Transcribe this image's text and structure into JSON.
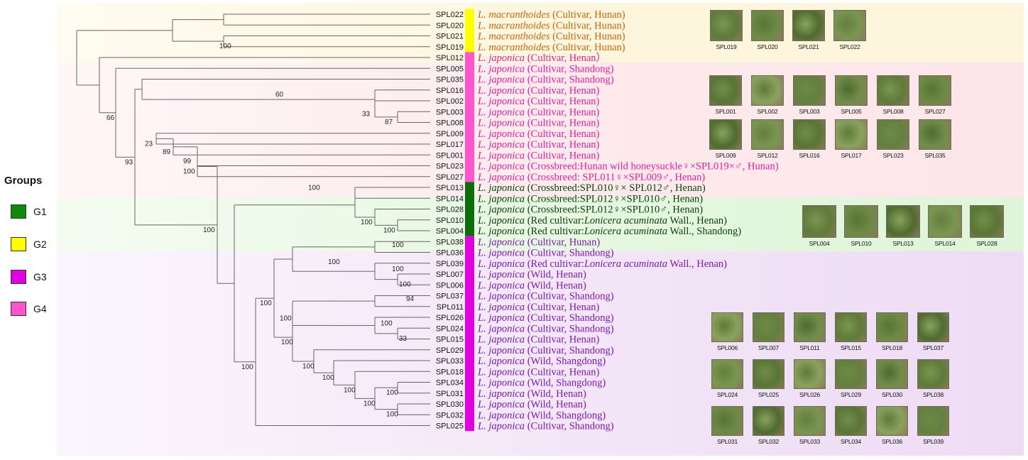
{
  "legend": {
    "title": "Groups",
    "items": [
      {
        "label": "G1",
        "color": "#0b8a0b"
      },
      {
        "label": "G2",
        "color": "#ffff00"
      },
      {
        "label": "G3",
        "color": "#e000e0"
      },
      {
        "label": "G4",
        "color": "#ff55cc"
      }
    ]
  },
  "taxa": [
    {
      "id": "SPL022",
      "species": "L. macranthoides",
      "detail": " (Cultivar, Hunan)",
      "color": "#c8640a"
    },
    {
      "id": "SPL020",
      "species": "L. macranthoides",
      "detail": " (Cultivar, Hunan)",
      "color": "#c8640a"
    },
    {
      "id": "SPL021",
      "species": "L. macranthoides",
      "detail": " (Cultivar, Hunan)",
      "color": "#c8640a"
    },
    {
      "id": "SPL019",
      "species": "L. macranthoides",
      "detail": " (Cultivar, Hunan)",
      "color": "#c8640a"
    },
    {
      "id": "SPL012",
      "species": "L. japonica",
      "detail": " (Cultivar, Henan）",
      "color": "#e0209a"
    },
    {
      "id": "SPL005",
      "species": "L. japonica",
      "detail": " (Cultivar, Shandong)",
      "color": "#e0209a"
    },
    {
      "id": "SPL035",
      "species": "L. japonica",
      "detail": " (Cultivar, Shandong)",
      "color": "#e0209a"
    },
    {
      "id": "SPL016",
      "species": "L. japonica",
      "detail": " (Cultivar, Henan)",
      "color": "#e0209a"
    },
    {
      "id": "SPL002",
      "species": "L. japonica",
      "detail": " (Cultivar, Henan)",
      "color": "#e0209a"
    },
    {
      "id": "SPL003",
      "species": "L. japonica",
      "detail": " (Cultivar, Henan)",
      "color": "#e0209a"
    },
    {
      "id": "SPL008",
      "species": "L. japonica",
      "detail": " (Cultivar, Henan)",
      "color": "#e0209a"
    },
    {
      "id": "SPL009",
      "species": "L. japonica",
      "detail": " (Cultivar, Henan)",
      "color": "#e0209a"
    },
    {
      "id": "SPL017",
      "species": "L. japonica",
      "detail": " (Cultivar, Henan)",
      "color": "#e0209a"
    },
    {
      "id": "SPL001",
      "species": "L. japonica",
      "detail": " (Cultivar, Henan)",
      "color": "#e0209a"
    },
    {
      "id": "SPL023",
      "species": "L. japonica",
      "detail": " (Crossbreed:Hunan wild honeysuckle♀×SPL019×♂, Hunan)",
      "color": "#e0209a"
    },
    {
      "id": "SPL027",
      "species": "L. japonica",
      "detail": " (Crossbreed: SPL011♀×SPL009♂, Henan)",
      "color": "#e0209a"
    },
    {
      "id": "SPL013",
      "species": "L. japonica",
      "detail": " (Crossbreed:SPL010♀× SPL012♂, Henan)",
      "color": "#0a3f0a"
    },
    {
      "id": "SPL014",
      "species": "L. japonica",
      "detail": " (Crossbreed:SPL012♀×SPL010♂, Henan)",
      "color": "#0a3f0a"
    },
    {
      "id": "SPL028",
      "species": "L. japonica",
      "detail": " (Crossbreed:SPL012♀×SPL010♂, Henan)",
      "color": "#0a3f0a"
    },
    {
      "id": "SPL010",
      "species": "L. japonica",
      "detail": " (Red cultivar:",
      "extra": "Lonicera acuminata",
      "tail": " Wall., Henan)",
      "color": "#0a3f0a"
    },
    {
      "id": "SPL004",
      "species": "L. japonica",
      "detail": " (Red cultivar:",
      "extra": "Lonicera acuminata",
      "tail": " Wall., Shandong)",
      "color": "#0a3f0a"
    },
    {
      "id": "SPL038",
      "species": "L. japonica",
      "detail": " (Cultivar, Hunan)",
      "color": "#7a1ab0"
    },
    {
      "id": "SPL036",
      "species": "L. japonica",
      "detail": " (Cultivar, Shandong)",
      "color": "#7a1ab0"
    },
    {
      "id": "SPL039",
      "species": "L. japonica",
      "detail": " (Red cultivar:",
      "extra": "Lonicera acuminata",
      "tail": " Wall., Henan)",
      "color": "#7a1ab0"
    },
    {
      "id": "SPL007",
      "species": "L. japonica",
      "detail": " (Wild, Henan)",
      "color": "#7a1ab0"
    },
    {
      "id": "SPL006",
      "species": "L. japonica",
      "detail": " (Wild, Henan)",
      "color": "#7a1ab0"
    },
    {
      "id": "SPL037",
      "species": "L. japonica",
      "detail": " (Cultivar, Shandong)",
      "color": "#7a1ab0"
    },
    {
      "id": "SPL011",
      "species": "L. japonica",
      "detail": " (Cultivar, Henan)",
      "color": "#7a1ab0"
    },
    {
      "id": "SPL026",
      "species": "L. japonica",
      "detail": " (Cultivar, Shandong)",
      "color": "#7a1ab0"
    },
    {
      "id": "SPL024",
      "species": "L. japonica",
      "detail": " (Cultivar, Shandong)",
      "color": "#7a1ab0"
    },
    {
      "id": "SPL015",
      "species": "L. japonica",
      "detail": " (Cultivar, Henan)",
      "color": "#7a1ab0"
    },
    {
      "id": "SPL029",
      "species": "L. japonica",
      "detail": " (Cultivar, Shandong)",
      "color": "#7a1ab0"
    },
    {
      "id": "SPL033",
      "species": "L. japonica",
      "detail": " (Wild, Shangdong)",
      "color": "#7a1ab0"
    },
    {
      "id": "SPL018",
      "species": "L. japonica",
      "detail": " (Cultivar, Henan)",
      "color": "#7a1ab0"
    },
    {
      "id": "SPL034",
      "species": "L. japonica",
      "detail": " (Wild, Shangdong)",
      "color": "#7a1ab0"
    },
    {
      "id": "SPL031",
      "species": "L. japonica",
      "detail": " (Wild, Henan)",
      "color": "#7a1ab0"
    },
    {
      "id": "SPL030",
      "species": "L. japonica",
      "detail": " (Wild, Henan)",
      "color": "#7a1ab0"
    },
    {
      "id": "SPL032",
      "species": "L. japonica",
      "detail": " (Wild, Shangdong)",
      "color": "#7a1ab0"
    },
    {
      "id": "SPL025",
      "species": "L. japonica",
      "detail": " (Cultivar, Shandong)",
      "color": "#7a1ab0"
    }
  ],
  "bars": [
    {
      "group": "G2",
      "from": "SPL022",
      "to": "SPL019",
      "color": "#ffff00"
    },
    {
      "group": "G4",
      "from": "SPL012",
      "to": "SPL027",
      "color": "#ff55cc"
    },
    {
      "group": "G1",
      "from": "SPL013",
      "to": "SPL004",
      "color": "#0b6e0b"
    },
    {
      "group": "G3",
      "from": "SPL038",
      "to": "SPL025",
      "color": "#e000e0"
    }
  ],
  "support_values": [
    "100",
    "66",
    "60",
    "93",
    "33",
    "87",
    "23",
    "89",
    "99",
    "100",
    "100",
    "100",
    "100",
    "100",
    "100",
    "100",
    "100",
    "100",
    "100",
    "100",
    "94",
    "33",
    "100",
    "100",
    "100",
    "100",
    "100",
    "100",
    "100",
    "100",
    "100",
    "100",
    "100",
    "100",
    "100",
    "100"
  ],
  "photo_panels": [
    {
      "group": "G2",
      "rows": [
        [
          "SPL019",
          "SPL020",
          "SPL021",
          "SPL022"
        ]
      ]
    },
    {
      "group": "G4",
      "rows": [
        [
          "SPL001",
          "SPL002",
          "SPL003",
          "SPL005",
          "SPL008",
          "SPL027"
        ],
        [
          "SPL009",
          "SPL012",
          "SPL016",
          "SPL017",
          "SPL023",
          "SPL035"
        ]
      ]
    },
    {
      "group": "G1",
      "rows": [
        [
          "SPL004",
          "SPL010",
          "SPL013",
          "SPL014",
          "SPL028"
        ]
      ]
    },
    {
      "group": "G3",
      "rows": [
        [
          "SPL006",
          "SPL007",
          "SPL011",
          "SPL015",
          "SPL018",
          "SPL037"
        ],
        [
          "SPL024",
          "SPL025",
          "SPL026",
          "SPL029",
          "SPL030",
          "SPL038"
        ],
        [
          "SPL031",
          "SPL032",
          "SPL033",
          "SPL034",
          "SPL036",
          "SPL039"
        ]
      ]
    }
  ]
}
